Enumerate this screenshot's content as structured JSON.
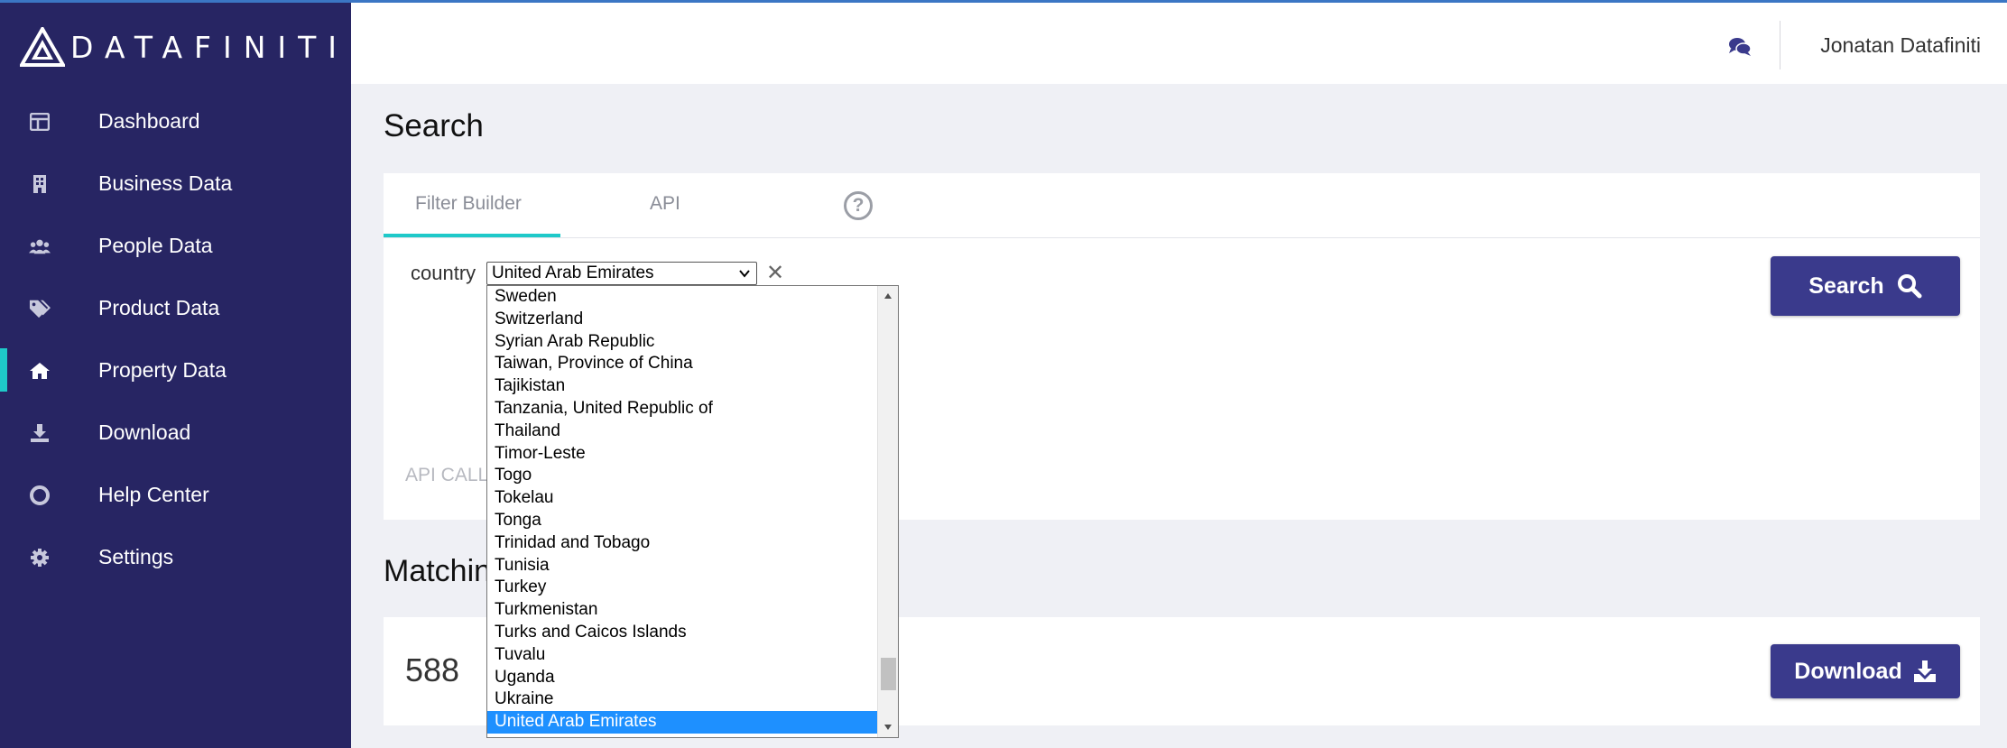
{
  "app": {
    "brand": "DATAFINITI",
    "colors": {
      "sidebar": "#272563",
      "accent": "#1fc9c9",
      "button": "#3a3a8c",
      "selected": "#1e90ff"
    }
  },
  "sidebar": {
    "items": [
      {
        "label": "Dashboard",
        "icon": "dashboard-icon",
        "active": false
      },
      {
        "label": "Business Data",
        "icon": "building-icon",
        "active": false
      },
      {
        "label": "People Data",
        "icon": "users-icon",
        "active": false
      },
      {
        "label": "Product Data",
        "icon": "tags-icon",
        "active": false
      },
      {
        "label": "Property Data",
        "icon": "home-icon",
        "active": true
      },
      {
        "label": "Download",
        "icon": "download-icon",
        "active": false
      },
      {
        "label": "Help Center",
        "icon": "life-ring-icon",
        "active": false
      },
      {
        "label": "Settings",
        "icon": "gear-icon",
        "active": false
      }
    ]
  },
  "header": {
    "user_name": "Jonatan Datafiniti",
    "chat_icon": "comments-icon"
  },
  "main": {
    "title": "Search",
    "tabs": [
      {
        "label": "Filter Builder",
        "active": true
      },
      {
        "label": "API",
        "active": false
      }
    ],
    "help_icon": "question-circle-icon",
    "filter": {
      "field_label": "country",
      "selected_value": "United Arab Emirates",
      "clear_symbol": "✕"
    },
    "search_button_label": "Search",
    "api_call_label": "API CALL",
    "matching_title": "Matching",
    "match_count": "588",
    "download_button_label": "Download"
  },
  "dropdown": {
    "options": [
      "Sweden",
      "Switzerland",
      "Syrian Arab Republic",
      "Taiwan, Province of China",
      "Tajikistan",
      "Tanzania, United Republic of",
      "Thailand",
      "Timor-Leste",
      "Togo",
      "Tokelau",
      "Tonga",
      "Trinidad and Tobago",
      "Tunisia",
      "Turkey",
      "Turkmenistan",
      "Turks and Caicos Islands",
      "Tuvalu",
      "Uganda",
      "Ukraine",
      "United Arab Emirates"
    ],
    "selected": "United Arab Emirates"
  }
}
